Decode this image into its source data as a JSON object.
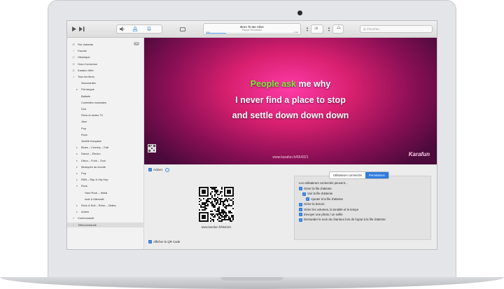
{
  "toolbar": {
    "play_icon": "play-icon",
    "next_icon": "next-icon",
    "volume_icon": "volume-icon",
    "now_playing_title": "Born To Be Alive",
    "now_playing_artist": "Patrick Hernandez",
    "time_elapsed": "0:54",
    "time_remaining": "-3:12",
    "progress_fraction": 0.22,
    "key_label": "#",
    "tempo_label": "♭b",
    "search_placeholder": "Q Chercher..."
  },
  "sidebar": {
    "queue_badge": "12",
    "items": [
      {
        "label": "File d'attente",
        "icon": "queue-icon",
        "indent": 0
      },
      {
        "label": "Favoris",
        "icon": "star-icon",
        "indent": 0
      },
      {
        "label": "Historique",
        "icon": "history-icon",
        "indent": 0
      },
      {
        "label": "Hors-Connexion",
        "icon": "offline-icon",
        "indent": 0
      },
      {
        "label": "Karafun Web",
        "icon": "web-icon",
        "indent": 0
      },
      {
        "label": "Tous les titres",
        "icon": "songs-icon",
        "indent": 0
      },
      {
        "label": "Nouveautés",
        "icon": "",
        "indent": 1
      },
      {
        "label": "Par langue",
        "icon": "arrow-icon",
        "indent": 1
      },
      {
        "label": "Ballade",
        "icon": "",
        "indent": 1
      },
      {
        "label": "Comédies musicales",
        "icon": "",
        "indent": 1
      },
      {
        "label": "Duo",
        "icon": "",
        "indent": 1
      },
      {
        "label": "Films et séries TV",
        "icon": "",
        "indent": 1
      },
      {
        "label": "Jazz",
        "icon": "",
        "indent": 1
      },
      {
        "label": "Pop",
        "icon": "",
        "indent": 1
      },
      {
        "label": "Rock",
        "icon": "",
        "indent": 1
      },
      {
        "label": "Variété française",
        "icon": "",
        "indent": 1
      },
      {
        "label": "Blues – Country – Folk",
        "icon": "arrow-icon",
        "indent": 1
      },
      {
        "label": "Dance – Electro",
        "icon": "arrow-icon",
        "indent": 1
      },
      {
        "label": "Disco – Funk – Soul",
        "icon": "arrow-icon",
        "indent": 1
      },
      {
        "label": "Musiques du monde",
        "icon": "arrow-icon",
        "indent": 1
      },
      {
        "label": "Pop",
        "icon": "arrow-icon",
        "indent": 1
      },
      {
        "label": "R&B – Rap & Hip-Hop",
        "icon": "arrow-icon",
        "indent": 1
      },
      {
        "label": "Rock",
        "icon": "arrow-down-icon",
        "indent": 1
      },
      {
        "label": "Hard Rock – Metal",
        "icon": "",
        "indent": 2
      },
      {
        "label": "Indé & Alternatif",
        "icon": "",
        "indent": 2
      },
      {
        "label": "Rock & Roll – Rétro – Oldies",
        "icon": "arrow-icon",
        "indent": 1
      },
      {
        "label": "Autres",
        "icon": "arrow-icon",
        "indent": 1
      },
      {
        "label": "Communauté",
        "icon": "community-icon",
        "indent": 0
      },
      {
        "label": "Télécommande",
        "icon": "remote-icon",
        "indent": 0
      }
    ],
    "selected_index": 28
  },
  "video": {
    "lyric_line1_sung": "People ask",
    "lyric_line1_rest": " me why",
    "lyric_line2": "I never find a place to stop",
    "lyric_line3": "and settle down down down",
    "url": "www.karafun.fr/654321",
    "logo": "Karafun"
  },
  "remote": {
    "activate_label": "Activer",
    "info_icon": "info-icon",
    "qr_url": "www.karafun.fr/654321",
    "show_qr_label": "Afficher le QR Code",
    "tab_connected": "Utilisateurs connectés",
    "tab_permissions": "Permissions",
    "permissions_title": "Les utilisateurs connectés peuvent...",
    "permissions": [
      {
        "label": "Gérer la file d'attente",
        "indent": 0
      },
      {
        "label": "Voir la file d'attente",
        "indent": 1
      },
      {
        "label": "Ajouter à la file d'attente",
        "indent": 2
      },
      {
        "label": "Gérer la lecture",
        "indent": 0
      },
      {
        "label": "Gérer les volumes, la tonalité et le tempo",
        "indent": 0
      },
      {
        "label": "Envoyer une photo / un selfie",
        "indent": 0
      },
      {
        "label": "Demander le nom du chanteur lors de l'ajout à la file d'attente",
        "indent": 0
      }
    ]
  },
  "colors": {
    "accent": "#2f7bde",
    "sung_lyric": "#7de83c",
    "video_bg": "#d8206f"
  }
}
